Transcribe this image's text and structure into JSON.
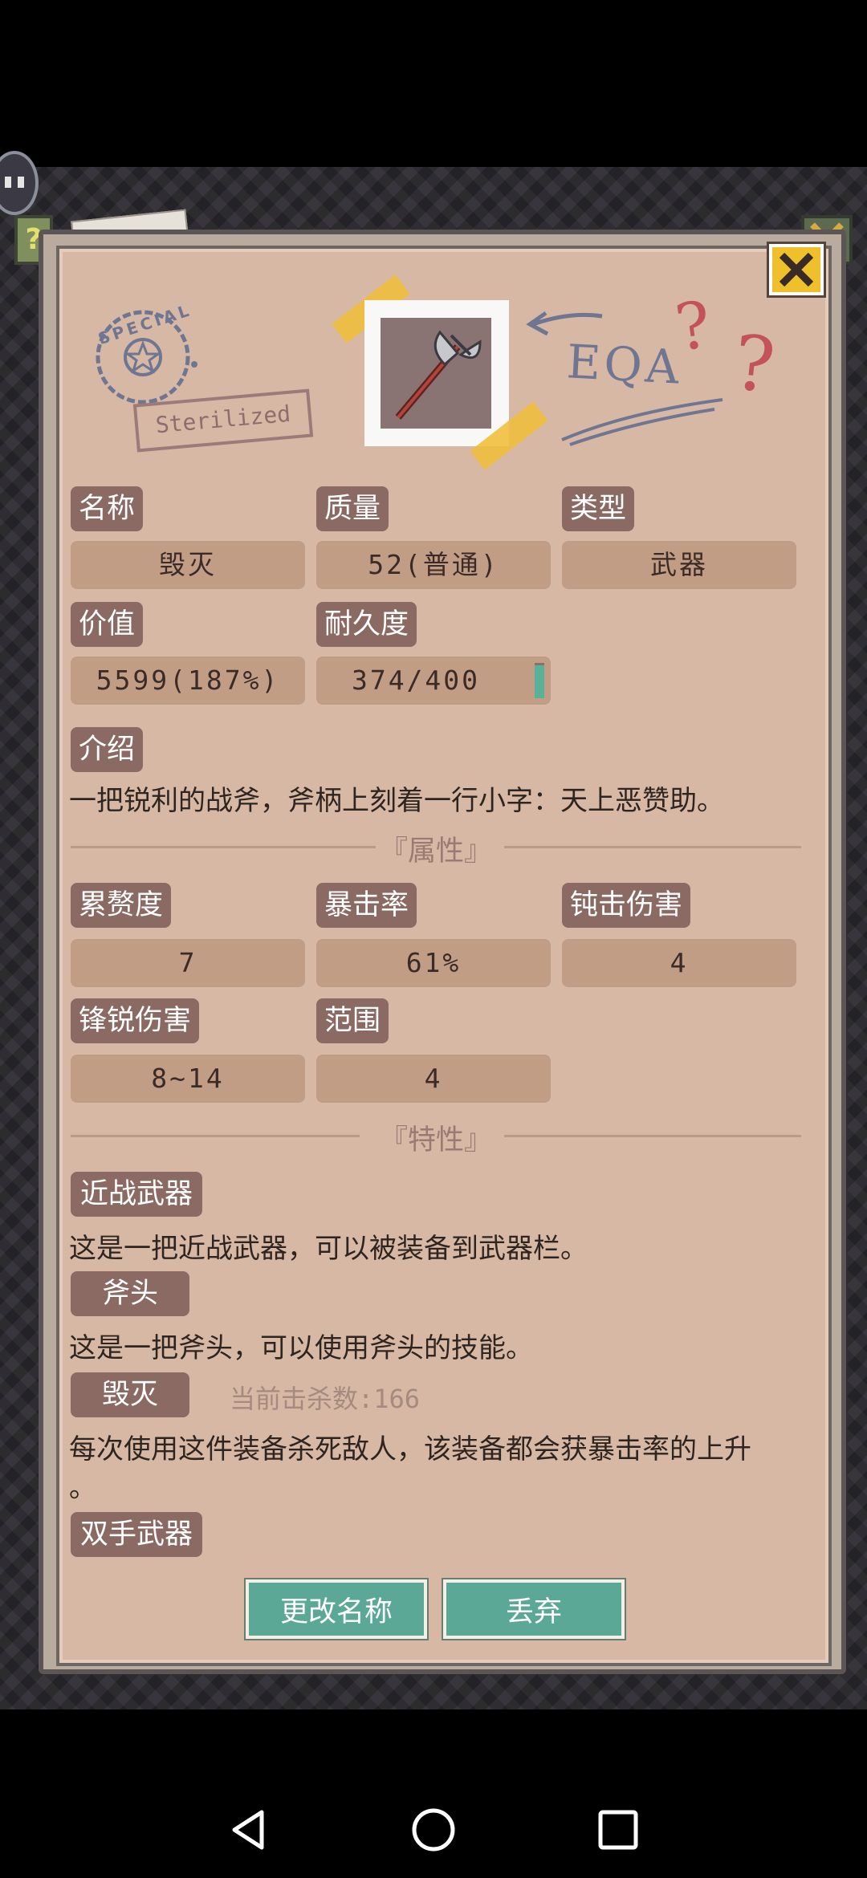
{
  "item": {
    "fields": {
      "name_label": "名称",
      "name_value": "毁灭",
      "quality_label": "质量",
      "quality_value": "52(普通)",
      "type_label": "类型",
      "type_value": "武器",
      "value_label": "价值",
      "value_value": "5599(187%)",
      "durability_label": "耐久度",
      "durability_value": "374/400"
    },
    "durability_fraction": 0.935,
    "intro_label": "介绍",
    "intro_text": "一把锐利的战斧，斧柄上刻着一行小字：天上恶赞助。"
  },
  "stamps": {
    "sterilized": "Sterilized",
    "special": "SPECIAL",
    "eqa": "EQA",
    "question": "?"
  },
  "attributes": {
    "title": "『属性』",
    "items": [
      {
        "label": "累赘度",
        "value": "7"
      },
      {
        "label": "暴击率",
        "value": "61%"
      },
      {
        "label": "钝击伤害",
        "value": "4"
      },
      {
        "label": "锋锐伤害",
        "value": "8~14"
      },
      {
        "label": "范围",
        "value": "4"
      }
    ]
  },
  "traits": {
    "title": "『特性』",
    "items": [
      {
        "label": "近战武器",
        "desc": "这是一把近战武器，可以被装备到武器栏。"
      },
      {
        "label": "斧头",
        "desc": "这是一把斧头，可以使用斧头的技能。"
      },
      {
        "label": "毁灭",
        "extra": "当前击杀数:166",
        "desc_line1": "每次使用这件装备杀死敌人，该装备都会获暴击率的上升",
        "desc_line2": "。"
      },
      {
        "label": "双手武器"
      }
    ]
  },
  "buttons": {
    "rename": "更改名称",
    "discard": "丢弃"
  },
  "colors": {
    "panel": "#d7b8a5",
    "label_bg": "#8a6a63",
    "value_bg": "#c29d86",
    "button": "#5aa895",
    "close_bg": "#e8b92e"
  },
  "icons": {
    "close": "close-icon",
    "help": "question-icon",
    "item": "battle-axe-icon",
    "back": "nav-back-icon",
    "home": "nav-home-icon",
    "recents": "nav-recents-icon"
  }
}
